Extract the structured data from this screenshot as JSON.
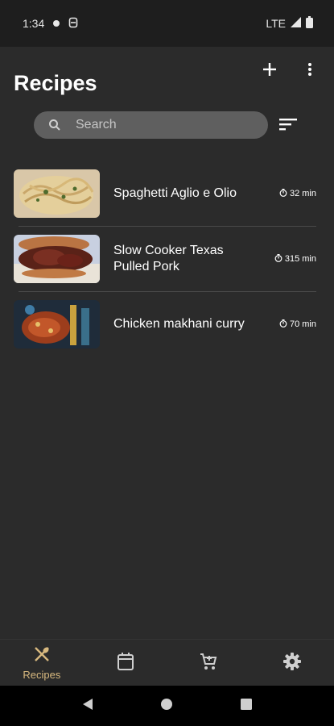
{
  "status_bar": {
    "time": "1:34",
    "network": "LTE"
  },
  "header": {
    "title": "Recipes",
    "add_icon": "plus-icon",
    "more_icon": "more-vertical-icon"
  },
  "search": {
    "placeholder": "Search",
    "value": ""
  },
  "recipes": [
    {
      "name": "Spaghetti Aglio e Olio",
      "time": "32 min"
    },
    {
      "name": "Slow Cooker Texas Pulled Pork",
      "time": "315 min"
    },
    {
      "name": "Chicken makhani curry",
      "time": "70 min"
    }
  ],
  "bottom_nav": {
    "items": [
      {
        "label": "Recipes",
        "icon": "utensils-icon",
        "active": true
      },
      {
        "label": "",
        "icon": "calendar-icon",
        "active": false
      },
      {
        "label": "",
        "icon": "cart-icon",
        "active": false
      },
      {
        "label": "",
        "icon": "gear-icon",
        "active": false
      }
    ]
  },
  "colors": {
    "background": "#2b2b2b",
    "search_bg": "#5f5f5f",
    "accent": "#d8b97f"
  }
}
